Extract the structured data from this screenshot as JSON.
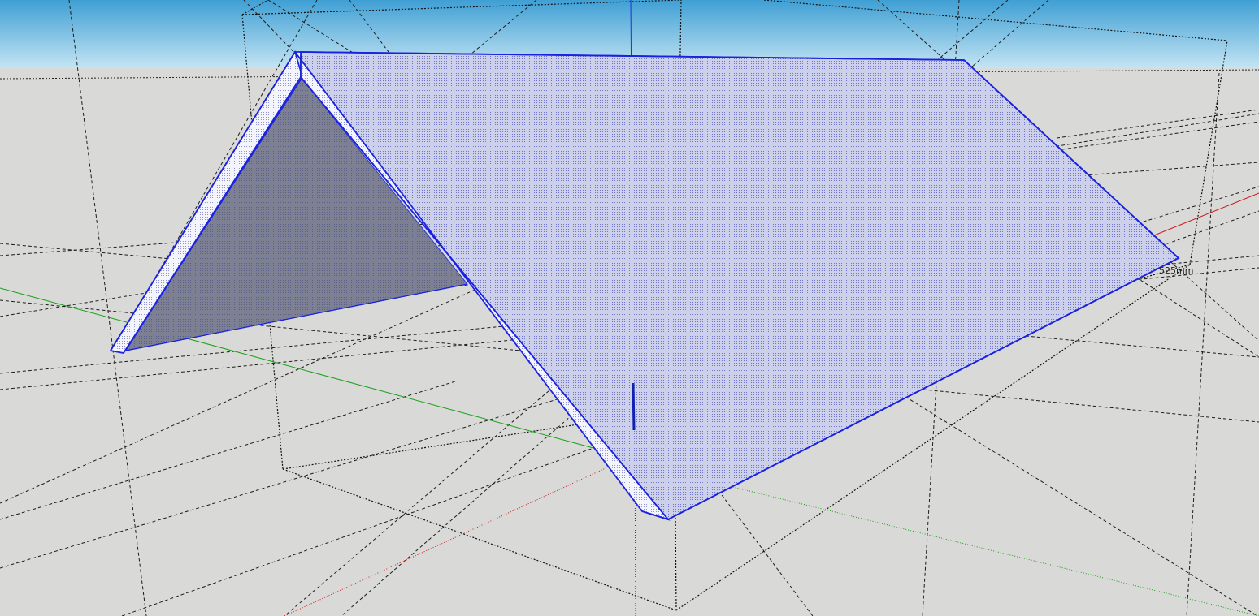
{
  "app": {
    "name": "",
    "view": "3d-modeling-viewport"
  },
  "scene": {
    "dimension_label": "525mm",
    "selected_object": "gable-roof",
    "axes": {
      "red": "x-axis",
      "green": "y-axis",
      "blue": "z-axis"
    }
  },
  "colors": {
    "sky_top": "#4aa6d8",
    "sky_bottom": "#c2e3f2",
    "ground": "#d9d9d7",
    "selection": "#1a22e0",
    "roof_face": "#c9cde8",
    "roof_edge_band": "#f2f3fb",
    "gable_shadow": "#7a7d8f",
    "guide_line": "#1c1c1c",
    "axis_red": "#d01818",
    "axis_green": "#18a018",
    "axis_blue": "#2030d0"
  }
}
